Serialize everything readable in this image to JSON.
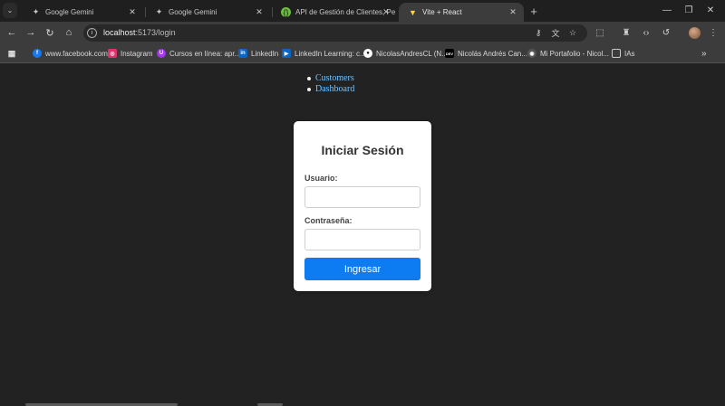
{
  "browser": {
    "tabs": [
      {
        "title": "Google Gemini",
        "icon": "gemini-icon",
        "active": false
      },
      {
        "title": "Google Gemini",
        "icon": "gemini-icon",
        "active": false
      },
      {
        "title": "API de Gestión de Clientes, Pe",
        "icon": "swagger-icon",
        "active": false
      },
      {
        "title": "Vite + React",
        "icon": "vite-icon",
        "active": true
      }
    ],
    "address": {
      "host": "localhost",
      "path": ":5173/login"
    },
    "bookmarks": [
      {
        "label": "www.facebook.com",
        "icon": "facebook-icon",
        "color": "#1877f2",
        "glyph": "f"
      },
      {
        "label": "Instagram",
        "icon": "instagram-icon",
        "color": "#e1306c",
        "glyph": "◎"
      },
      {
        "label": "Cursos en línea: apr...",
        "icon": "course-icon",
        "color": "#a435f0",
        "glyph": "U"
      },
      {
        "label": "LinkedIn",
        "icon": "linkedin-icon",
        "color": "#0a66c2",
        "glyph": "in"
      },
      {
        "label": "LinkedIn Learning: c...",
        "icon": "linkedin-learning-icon",
        "color": "#0a66c2",
        "glyph": "▶"
      },
      {
        "label": "NicolasAndresCL (N...",
        "icon": "github-icon",
        "color": "#111111",
        "glyph": "●"
      },
      {
        "label": "Nicolás Andrés Can...",
        "icon": "dev-icon",
        "color": "#000000",
        "glyph": "DEV"
      },
      {
        "label": "Mi Portafolio - Nicol...",
        "icon": "globe-icon",
        "color": "#555555",
        "glyph": "◉"
      },
      {
        "label": "IAs",
        "icon": "folder-icon",
        "color": "#3c3c3c",
        "glyph": "▭"
      }
    ]
  },
  "page": {
    "nav_links": [
      "Customers",
      "Dashboard"
    ],
    "login": {
      "title": "Iniciar Sesión",
      "username_label": "Usuario:",
      "password_label": "Contraseña:",
      "submit_label": "Ingresar",
      "username_value": "",
      "password_value": ""
    }
  },
  "colors": {
    "page_background": "#222222",
    "card_background": "#ffffff",
    "button_blue": "#0d7cf2",
    "link_blue": "#72c3ff"
  }
}
